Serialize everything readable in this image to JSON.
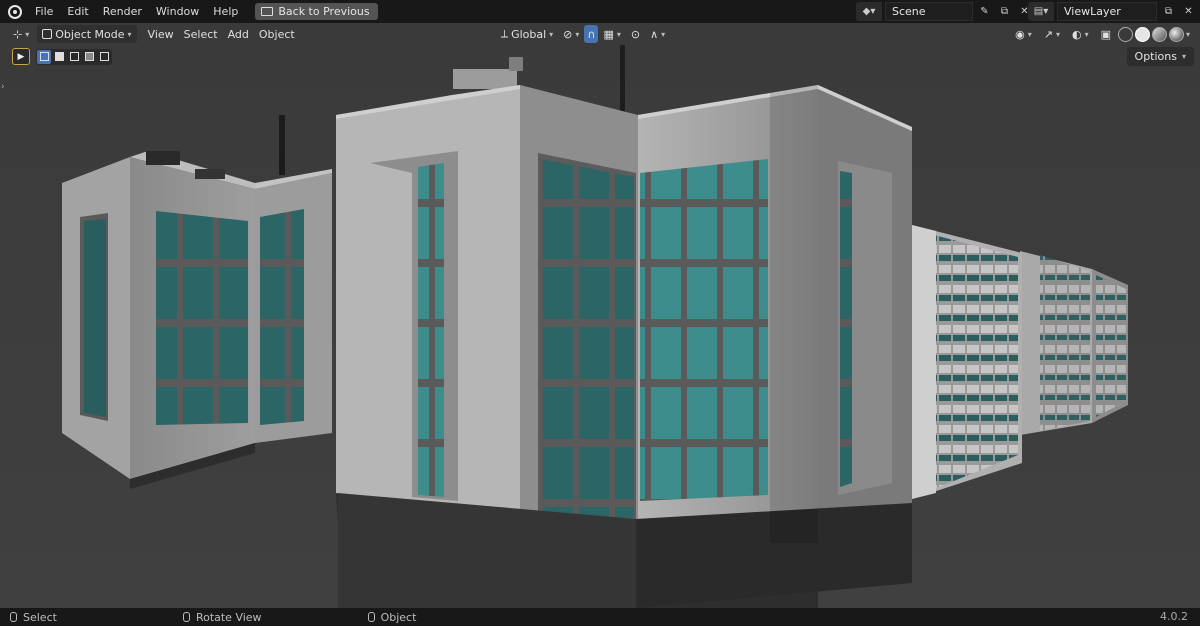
{
  "menu": {
    "file": "File",
    "edit": "Edit",
    "render": "Render",
    "window": "Window",
    "help": "Help"
  },
  "back_button": "Back to Previous",
  "scene": {
    "label": "Scene"
  },
  "view_layer": {
    "label": "ViewLayer"
  },
  "viewport_header": {
    "mode": "Object Mode",
    "view": "View",
    "select": "Select",
    "add": "Add",
    "object": "Object",
    "transform_orientation": "Global"
  },
  "options_label": "Options",
  "status_bar": {
    "select": "Select",
    "rotate": "Rotate View",
    "object": "Object",
    "version": "4.0.2"
  },
  "colors": {
    "viewport_bg": "#3d3d3d",
    "building_light": "#aaaaaa",
    "building_shadow": "#6a6a6a",
    "base_dark": "#303030",
    "glass": "#2f6a6a",
    "glass_light": "#3f9494",
    "accent_blue": "#4772b3"
  }
}
